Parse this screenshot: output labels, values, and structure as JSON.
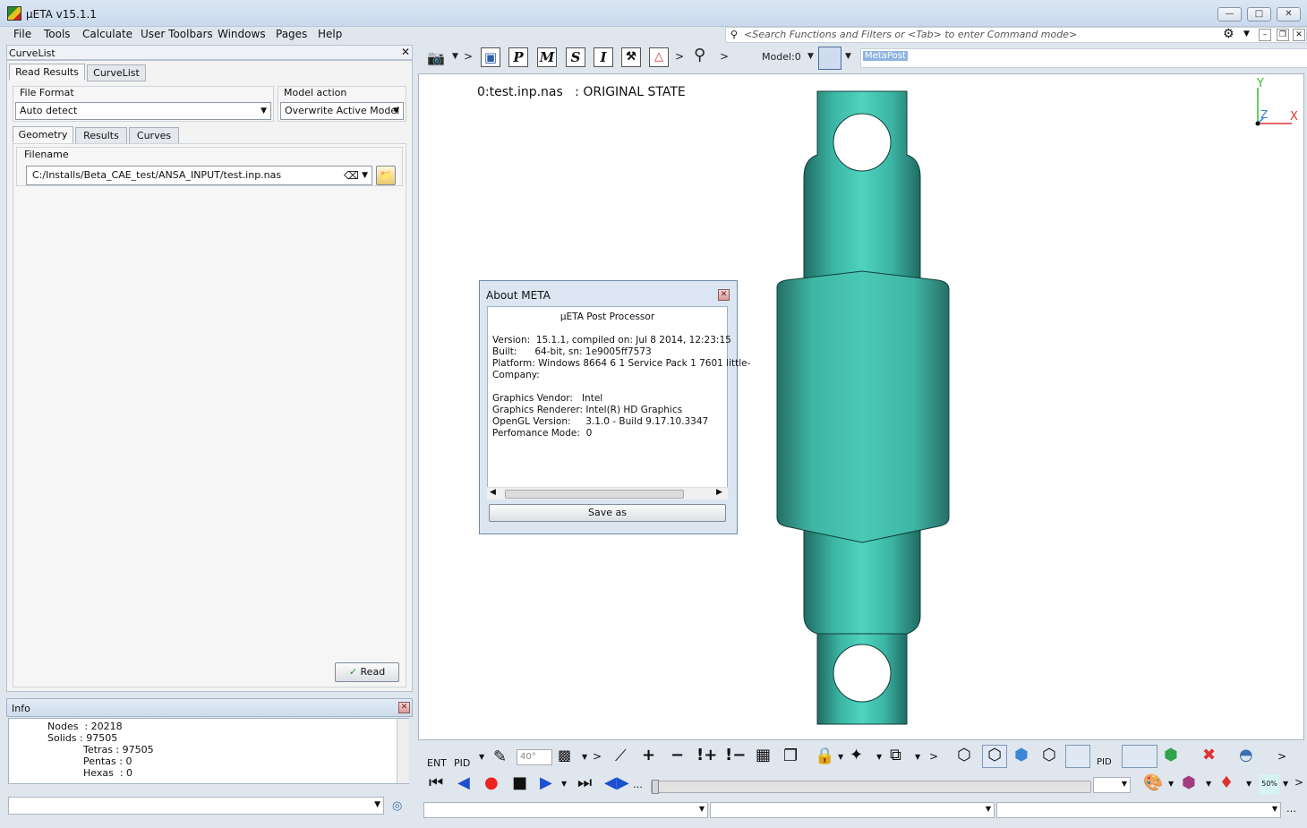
{
  "window": {
    "title": "µETA v15.1.1"
  },
  "menu": [
    "File",
    "Tools",
    "Calculate",
    "User Toolbars",
    "Windows",
    "Pages",
    "Help"
  ],
  "search": {
    "placeholder": "<Search Functions and Filters or <Tab> to enter Command mode>"
  },
  "left_panel": {
    "header": "CurveList",
    "tabs": [
      "Read Results",
      "CurveList"
    ],
    "file_format": {
      "label": "File Format",
      "value": "Auto detect"
    },
    "model_action": {
      "label": "Model action",
      "value": "Overwrite Active Model"
    },
    "subtabs": [
      "Geometry",
      "Results",
      "Curves"
    ],
    "filename": {
      "label": "Filename",
      "value": "C:/Installs/Beta_CAE_test/ANSA_INPUT/test.inp.nas"
    },
    "read_button": "Read"
  },
  "info": {
    "title": "Info",
    "lines": [
      "Nodes  : 20218",
      "Solids : 97505",
      "Tetras : 97505",
      "Pentas : 0",
      "Hexas  : 0"
    ]
  },
  "toolbar": {
    "model_label": "Model:0",
    "metapost_label": "MetaPost"
  },
  "viewport": {
    "label": "0:test.inp.nas   : ORIGINAL STATE",
    "axes": {
      "y": "Y",
      "x": "X",
      "z": "Z"
    }
  },
  "about_dialog": {
    "title": "About META",
    "product": "µETA Post Processor",
    "version": "Version:  15.1.1, compiled on: Jul 8 2014, 12:23:15",
    "built": "Built:      64-bit, sn: 1e9005ff7573",
    "platform": "Platform: Windows 8664 6 1 Service Pack 1 7601 little-",
    "company": "Company:",
    "vendor": "Graphics Vendor:   Intel",
    "renderer": "Graphics Renderer: Intel(R) HD Graphics",
    "opengl": "OpenGL Version:     3.1.0 - Build 9.17.10.3347",
    "perf": "Perfomance Mode:  0",
    "save_button": "Save as"
  },
  "bottom_toolbar": {
    "ent": "ENT",
    "pid": "PID",
    "angle": "40°",
    "pid2": "PID",
    "zoom": "50%"
  },
  "colors": {
    "mesh": "#3fb9a8",
    "mesh_dark": "#2e8f82",
    "accent": "#3a6fb0"
  }
}
